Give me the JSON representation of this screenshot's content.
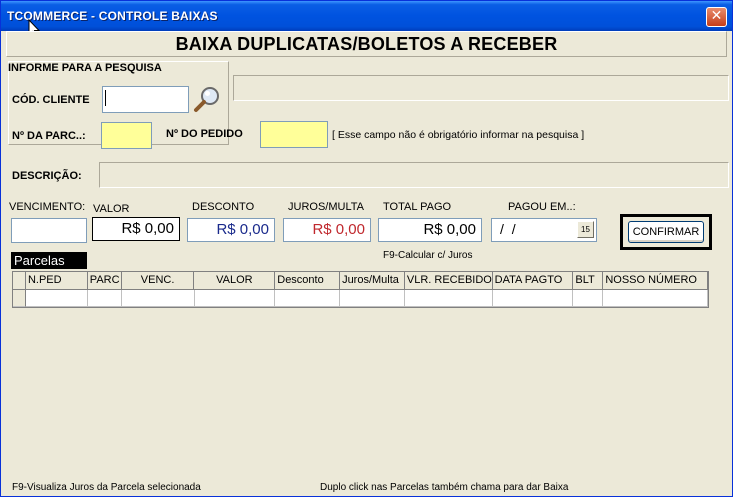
{
  "window": {
    "title": "TCOMMERCE - CONTROLE BAIXAS",
    "close_glyph": "✕"
  },
  "header": {
    "title": "BAIXA DUPLICATAS/BOLETOS A RECEBER"
  },
  "search": {
    "group_label": "INFORME PARA A PESQUISA",
    "client_code_label": "CÓD. CLIENTE",
    "client_code_value": "",
    "client_name_value": "",
    "search_icon": "magnifier-icon",
    "parcel_label": "Nº DA PARC..:",
    "parcel_value": "",
    "order_label": "Nº DO PEDIDO",
    "order_value": "",
    "order_hint": "[ Esse campo não é obrigatório informar na pesquisa ]",
    "description_label": "DESCRIÇÃO:",
    "description_value": ""
  },
  "payment": {
    "due_label": "VENCIMENTO:",
    "due_value": "",
    "value_label": "VALOR",
    "value_value": "R$ 0,00",
    "discount_label": "DESCONTO",
    "discount_value": "R$ 0,00",
    "interest_label": "JUROS/MULTA",
    "interest_value": "R$ 0,00",
    "total_label": "TOTAL PAGO",
    "total_value": "R$ 0,00",
    "total_hint": "F9-Calcular c/ Juros",
    "paid_on_label": "PAGOU EM..:",
    "paid_on_value": "/ /",
    "calendar_glyph": "15",
    "confirm_label": "CONFIRMAR"
  },
  "colors": {
    "discount_text": "#1a2a8c",
    "interest_text": "#c0282d",
    "yellow_field": "#ffff99",
    "title_bar": "#0053e0"
  },
  "parcelas": {
    "tab_label": "Parcelas",
    "columns": [
      "N.PED",
      "PARC",
      "VENC.",
      "VALOR",
      "Desconto",
      "Juros/Multa",
      "VLR. RECEBIDO",
      "DATA PAGTO",
      "BLT",
      "NOSSO NÚMERO"
    ]
  },
  "status": {
    "left": "F9-Visualiza Juros da Parcela selecionada",
    "right": "Duplo click nas Parcelas também chama para dar Baixa"
  }
}
